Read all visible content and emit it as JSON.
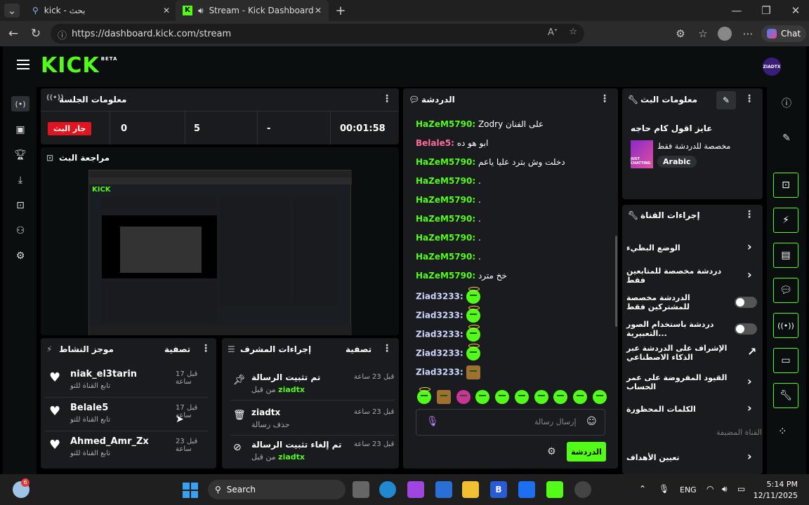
{
  "browser": {
    "tab1_title": "kick - بحث",
    "tab2_title": "Stream - Kick Dashboard",
    "new_tab": "+",
    "url": "https://dashboard.kick.com/stream",
    "copilot_label": "Chat"
  },
  "header": {
    "logo": "KICK",
    "beta": "BETA",
    "avatar": "ZIADTX"
  },
  "session": {
    "title": "معلومات الجلسة",
    "live_badge": "جار البث",
    "stats": [
      "0",
      "5",
      "-",
      "00:01:58"
    ]
  },
  "preview": {
    "title": "مراجعة البث"
  },
  "activity": {
    "title": "موجز النشاط",
    "filter": "تصفية",
    "items": [
      {
        "name": "niak_el3tarin",
        "sub": "تابع القناة للتو",
        "time": "قبل 17 ساعة"
      },
      {
        "name": "Belale5",
        "sub": "تابع القناة للتو",
        "time": "قبل 17 ساعة"
      },
      {
        "name": "Ahmed_Amr_Zx",
        "sub": "تابع القناة للتو",
        "time": "قبل 23 ساعة"
      }
    ]
  },
  "mod": {
    "title": "إجراءات المشرف",
    "filter": "تصفية",
    "items": [
      {
        "title": "تم تثبيت الرسالة",
        "by": "من قبل",
        "user": "ziadtx",
        "time": "قبل 23 ساعة"
      },
      {
        "title": "ziadtx",
        "by": "حذف رسالة",
        "user": "",
        "time": "قبل 23 ساعة"
      },
      {
        "title": "تم إلغاء تثبيت الرسالة",
        "by": "من قبل",
        "user": "ziadtx",
        "time": "قبل 23 ساعة"
      }
    ]
  },
  "chat": {
    "title": "الدردشة",
    "messages": [
      {
        "user": "HaZeM5790:",
        "text": "Zodry على الفنان",
        "color": "#53fc18"
      },
      {
        "user": "Belale5:",
        "text": "ابو هو ده",
        "color": "#ff6b9a"
      },
      {
        "user": "HaZeM5790:",
        "text": "دخلت وش بترد عليا ياعم",
        "color": "#53fc18"
      },
      {
        "user": "HaZeM5790:",
        "text": ".",
        "color": "#53fc18"
      },
      {
        "user": "HaZeM5790:",
        "text": ".",
        "color": "#53fc18"
      },
      {
        "user": "HaZeM5790:",
        "text": ".",
        "color": "#53fc18"
      },
      {
        "user": "HaZeM5790:",
        "text": ".",
        "color": "#53fc18"
      },
      {
        "user": "HaZeM5790:",
        "text": ".",
        "color": "#53fc18"
      },
      {
        "user": "HaZeM5790:",
        "text": "خخ مترد",
        "color": "#53fc18"
      },
      {
        "user": "Ziad3233:",
        "text": "",
        "color": "#cfd6ff"
      },
      {
        "user": "Ziad3233:",
        "text": "",
        "color": "#cfd6ff"
      },
      {
        "user": "Ziad3233:",
        "text": "",
        "color": "#cfd6ff"
      },
      {
        "user": "Ziad3233:",
        "text": "",
        "color": "#cfd6ff"
      },
      {
        "user": "Ziad3233:",
        "text": "",
        "color": "#cfd6ff"
      }
    ],
    "input_placeholder": "إرسال رسالة",
    "send_label": "الدردشة"
  },
  "stream_info": {
    "title": "معلومات البث",
    "stream_title": "عايز اقول كام حاجه",
    "category": "مخصصة للدردشة فقط",
    "language": "Arabic",
    "thumb_text": "JUST CHATTING"
  },
  "channel_actions": {
    "title": "إجراءات القناة",
    "items": [
      {
        "label": "الوضع البطيء",
        "control": "chevron"
      },
      {
        "label": "دردشة مخصصة للمتابعين فقط",
        "control": "chevron"
      },
      {
        "label": "الدردشة مخصصة للمشتركين فقط",
        "control": "toggle"
      },
      {
        "label": "دردشة باستخدام الصور التعبيرية...",
        "control": "toggle"
      },
      {
        "label": "الإشراف على الدردشة عبر الذكاء الاصطناعي",
        "control": "external"
      },
      {
        "label": "القيود المفروضة على عمر الحساب",
        "control": "chevron"
      },
      {
        "label": "الكلمات المحظورة",
        "control": "chevron"
      }
    ],
    "section_label": "القناة المضيفة",
    "last_item": "تعيين الأهداف"
  },
  "taskbar": {
    "search": "Search",
    "lang": "ENG",
    "time": "5:14 PM",
    "date": "12/11/2025",
    "badge": "6"
  },
  "colors": {
    "accent": "#53fc18",
    "live": "#e0151f",
    "panel": "#191b1f"
  }
}
